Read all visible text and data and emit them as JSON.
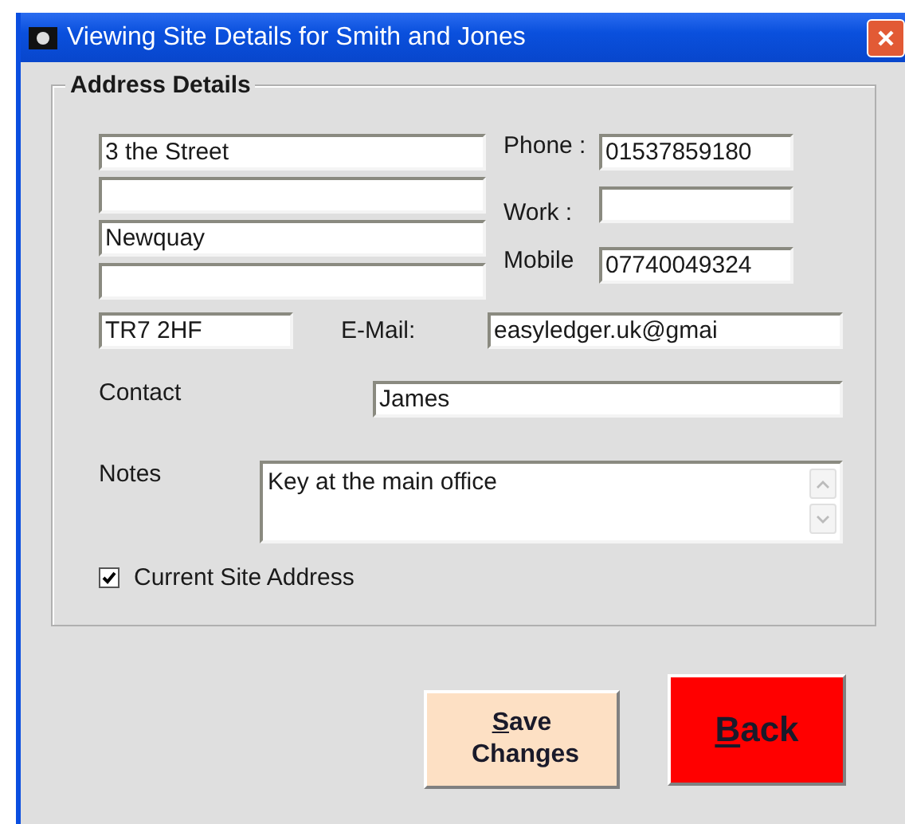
{
  "window": {
    "title": "Viewing Site Details for Smith and Jones"
  },
  "group": {
    "title": "Address Details"
  },
  "address_lines": [
    {
      "kind": "filled",
      "value": "3 the Street"
    },
    {
      "kind": "blank"
    },
    {
      "kind": "filled",
      "value": "Newquay"
    },
    {
      "kind": "blank"
    }
  ],
  "phones": [
    {
      "label": "Phone :",
      "value": "01537859180"
    },
    {
      "label": "Work :"
    },
    {
      "label": "Mobile",
      "value": "07740049324"
    }
  ],
  "postcode": {
    "value": "TR7 2HF"
  },
  "email": {
    "label": "E-Mail:",
    "value": "easyledger.uk@gmai"
  },
  "contact": {
    "label": "Contact",
    "value": "James"
  },
  "notes": {
    "label": "Notes",
    "value": "Key at the main office"
  },
  "current_site": {
    "label": "Current Site Address",
    "checked": true
  },
  "buttons": [
    {
      "kind": "save",
      "label": "Save Changes",
      "mnemonic": true
    },
    {
      "kind": "back",
      "label": "Back",
      "mnemonic": true
    }
  ]
}
